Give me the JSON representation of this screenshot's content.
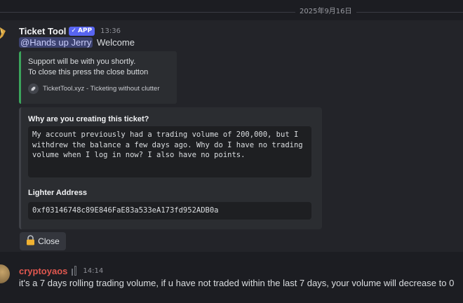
{
  "date_divider": "2025年9月16日",
  "message1": {
    "author": "Ticket Tool",
    "badge_check": "✓",
    "badge": "APP",
    "timestamp": "13:36",
    "mention": "@Hands up Jerry",
    "text": "Welcome",
    "embed_intro": {
      "lines": [
        "Support will be with you shortly.",
        "To close this press the close button"
      ],
      "footer_icon": "ticket-tool-logo-icon",
      "footer_text": "TicketTool.xyz - Ticketing without clutter",
      "accent_color": "#3ba55c"
    },
    "embed_fields": [
      {
        "name": "Why are you creating this ticket?",
        "value": "My account previously had a trading volume of 200,000, but I withdrew the balance a few days ago. Why do I have no trading volume when I log in now? I also have no points."
      },
      {
        "name": "Lighter Address",
        "value": "0xf03146748c89E846FaE83a533eA173fd952ADB0a"
      }
    ],
    "close_button": {
      "icon": "lock-icon",
      "label": "Close"
    }
  },
  "message2": {
    "author": "cryptoyaos",
    "author_color": "#e0574f",
    "role_icon": "role-badge-icon",
    "timestamp": "14:14",
    "text": "it's a 7 days rolling trading volume, if u have not traded within the last 7 days, your volume will decrease to 0"
  }
}
